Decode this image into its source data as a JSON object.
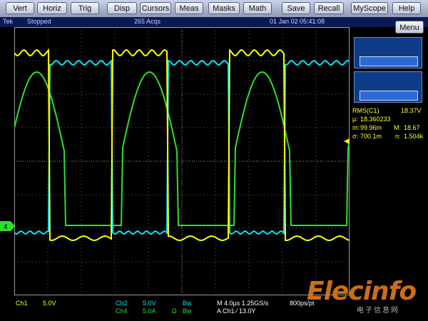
{
  "menu": {
    "buttons": [
      "Vert",
      "Horiz",
      "Trig",
      "Disp",
      "Cursors",
      "Meas",
      "Masks",
      "Math",
      "Save",
      "Recall",
      "MyScope",
      "Help"
    ]
  },
  "status": {
    "brand": "Tek",
    "state": "Stopped",
    "acqs": "265 Acqs",
    "datetime": "01 Jan 02  05:41:08",
    "menu_label": "Menu"
  },
  "measurement": {
    "name": "RMS(C1)",
    "value": "18.37V",
    "mu_label": "µ:",
    "mu_value": "18.360233",
    "m_label": "m:",
    "m_value": "99.96m",
    "M_label": "M:",
    "M_value": "18.67",
    "sigma_label": "σ:",
    "sigma_value": "700.1m",
    "n_label": "n:",
    "n_value": "1.504k"
  },
  "channels": {
    "ch1": {
      "label": "Ch1",
      "scale": "5.0V"
    },
    "ch2": {
      "label": "Ch2",
      "scale": "5.0V",
      "bw": "Bw"
    },
    "ch4": {
      "label": "Ch4",
      "scale": "5.0A",
      "bw": "Bw",
      "coupling": "Ω"
    }
  },
  "timebase": {
    "horiz": "M 4.0µs 1.25GS/s",
    "rate": "800ps/pt",
    "trigger": "A  Ch1  ⁄  13.0Y"
  },
  "markers": {
    "ch4_marker": "4"
  },
  "watermark": {
    "text": "Elecinfo",
    "sub": "电子信息网"
  },
  "colors": {
    "ch1": "#ffff00",
    "ch2": "#00e6ff",
    "ch4": "#2ee02e",
    "background": "#000000"
  }
}
